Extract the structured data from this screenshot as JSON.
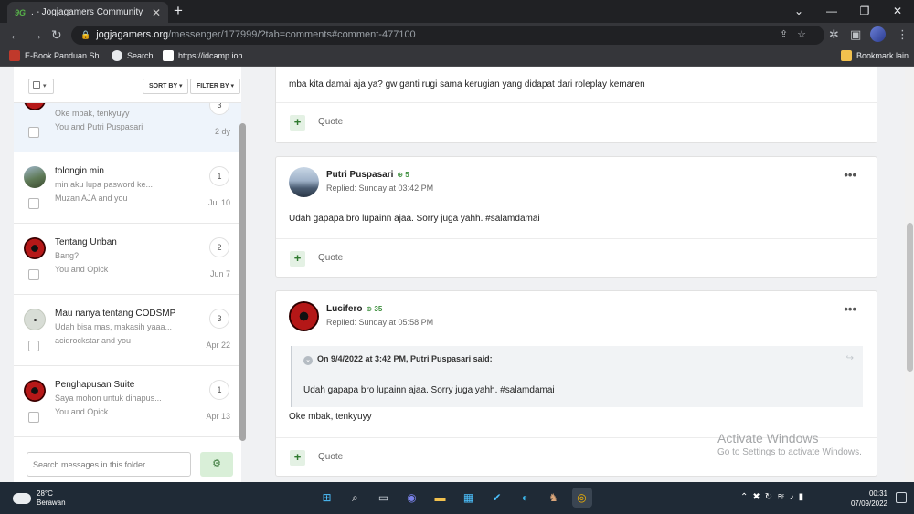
{
  "browser": {
    "tab_title": ". - Jogjagamers Community",
    "tab_favicon": "9G",
    "new_tab": "+",
    "window_controls": [
      "⌄",
      "—",
      "❐",
      "✕"
    ],
    "url_host": "jogjagamers.org",
    "url_path": "/messenger/177999/?tab=comments#comment-477100",
    "bookmarks": [
      {
        "label": "E-Book Panduan Sh..."
      },
      {
        "label": "Search"
      },
      {
        "label": "https://idcamp.ioh...."
      }
    ],
    "bookmarks_other": "Bookmark lain"
  },
  "sidebar": {
    "sort_label": "SORT BY",
    "filter_label": "FILTER BY",
    "search_placeholder": "Search messages in this folder...",
    "conversations": [
      {
        "title": "",
        "snippet": "Oke mbak, tenkyuyy",
        "people": "You and Putri Puspasari",
        "count": "3",
        "date": "2 dy",
        "avatar": "red-avatar"
      },
      {
        "title": "tolongin min",
        "snippet": "min aku lupa pasword ke...",
        "people": "Muzan AJA and you",
        "count": "1",
        "date": "Jul 10",
        "avatar": "photo-avatar"
      },
      {
        "title": "Tentang Unban",
        "snippet": "Bang?",
        "people": "You and Opick",
        "count": "2",
        "date": "Jun 7",
        "avatar": "red-avatar"
      },
      {
        "title": "Mau nanya tentang CODSMP",
        "snippet": "Udah bisa mas, makasih yaaa...",
        "people": "acidrockstar and you",
        "count": "3",
        "date": "Apr 22",
        "avatar": "grey-avatar"
      },
      {
        "title": "Penghapusan Suite",
        "snippet": "Saya mohon untuk dihapus...",
        "people": "You and Opick",
        "count": "1",
        "date": "Apr 13",
        "avatar": "red-avatar"
      }
    ]
  },
  "posts": [
    {
      "body": "mba kita damai aja ya? gw ganti rugi sama kerugian yang didapat dari roleplay kemaren",
      "quote_label": "Quote"
    },
    {
      "author": "Putri Puspasari",
      "rep": "5",
      "replied": "Replied: Sunday at 03:42 PM",
      "body": "Udah gapapa bro lupainn ajaa. Sorry juga yahh. #salamdamai",
      "quote_label": "Quote",
      "more": "•••"
    },
    {
      "author": "Lucifero",
      "rep": "35",
      "replied": "Replied: Sunday at 05:58 PM",
      "quote_header": "On 9/4/2022 at 3:42 PM, Putri Puspasari said:",
      "quote_text": "Udah gapapa bro lupainn ajaa. Sorry juga yahh. #salamdamai",
      "body": "Oke mbak, tenkyuyy",
      "quote_label": "Quote",
      "more": "•••"
    }
  ],
  "watermark": {
    "line1": "Activate Windows",
    "line2": "Go to Settings to activate Windows."
  },
  "taskbar": {
    "temp": "28°C",
    "weather": "Berawan",
    "time": "00:31",
    "date": "07/09/2022"
  },
  "colors": {
    "accent_green": "#3d8f3d",
    "chrome_dark": "#202124",
    "taskbar": "#1f2a36"
  }
}
